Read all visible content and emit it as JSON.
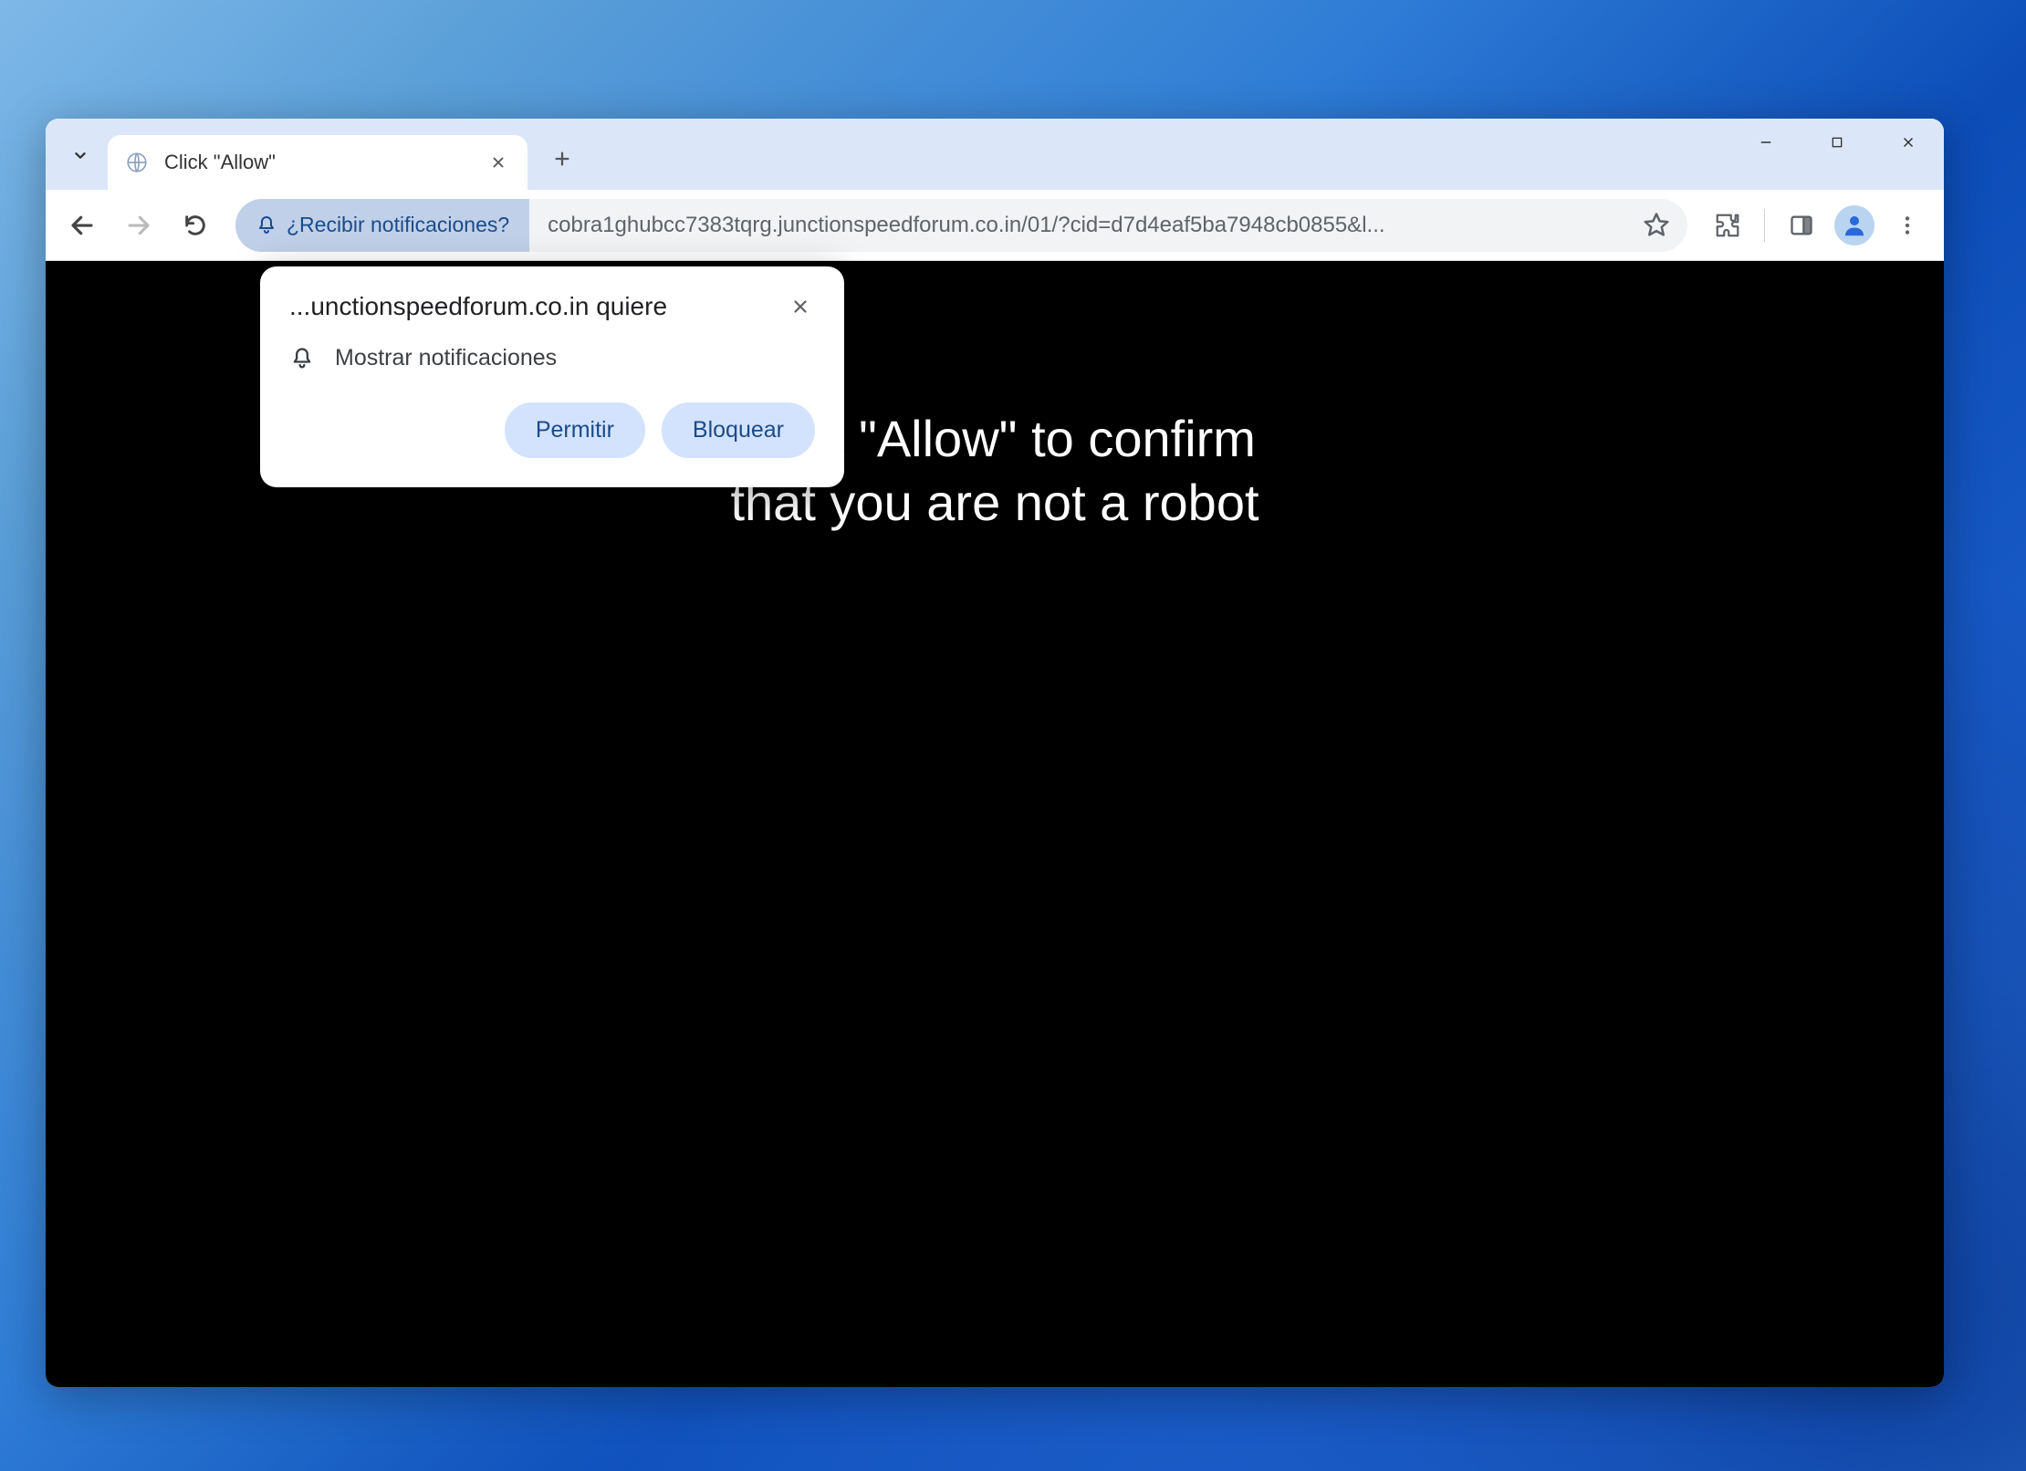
{
  "tab": {
    "title": "Click \"Allow\""
  },
  "toolbar": {
    "notification_chip": "¿Recibir notificaciones?",
    "url": "cobra1ghubcc7383tqrg.junctionspeedforum.co.in/01/?cid=d7d4eaf5ba7948cb0855&l..."
  },
  "popup": {
    "title": "...unctionspeedforum.co.in quiere",
    "permission_label": "Mostrar notificaciones",
    "allow_label": "Permitir",
    "block_label": "Bloquear"
  },
  "page": {
    "heading_line1": "Click \"Allow\" to confirm",
    "heading_line2": "that you are not a robot"
  }
}
